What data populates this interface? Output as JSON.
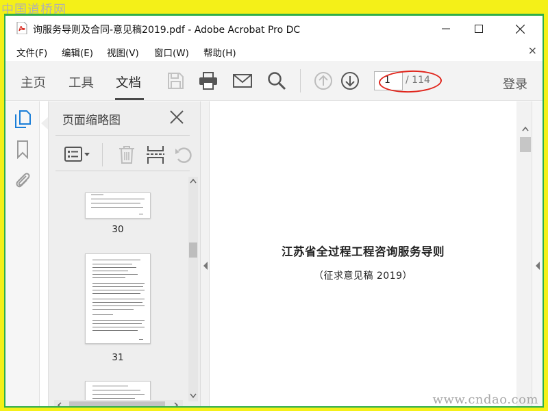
{
  "watermark": {
    "top": "中国道桥网",
    "bottom": "www.cndao.com"
  },
  "window": {
    "title": "询服务导则及合同-意见稿2019.pdf - Adobe Acrobat Pro DC",
    "controls": [
      "minimize-icon",
      "maximize-icon",
      "close-icon"
    ]
  },
  "menu": {
    "items": [
      {
        "label": "文件(F)"
      },
      {
        "label": "编辑(E)"
      },
      {
        "label": "视图(V)"
      },
      {
        "label": "窗口(W)"
      },
      {
        "label": "帮助(H)"
      }
    ],
    "close_glyph": "×"
  },
  "toolbar": {
    "tabs": [
      {
        "label": "主页",
        "active": false
      },
      {
        "label": "工具",
        "active": false
      },
      {
        "label": "文档",
        "active": true
      }
    ],
    "icons": [
      "save-icon",
      "print-icon",
      "email-icon",
      "search-icon",
      "page-up-icon",
      "page-down-icon"
    ],
    "page": {
      "current": "1",
      "total": "/ 114"
    },
    "login": "登录"
  },
  "left_rail": {
    "icons": [
      "page-thumbnails-icon",
      "bookmark-icon",
      "attachment-icon"
    ]
  },
  "thumbnails": {
    "title": "页面缩略图",
    "tools": [
      "options-menu-icon",
      "delete-icon",
      "extract-icon",
      "rotate-icon"
    ],
    "pages": [
      {
        "label": "30"
      },
      {
        "label": "31"
      },
      {
        "label": ""
      }
    ]
  },
  "document": {
    "title": "江苏省全过程工程咨询服务导则",
    "subtitle": "（征求意见稿 2019）"
  },
  "colors": {
    "background": "#f4f018",
    "frame_border": "#2fae4a",
    "annotation_oval": "#e0241b",
    "pdf_red": "#d8261c"
  }
}
